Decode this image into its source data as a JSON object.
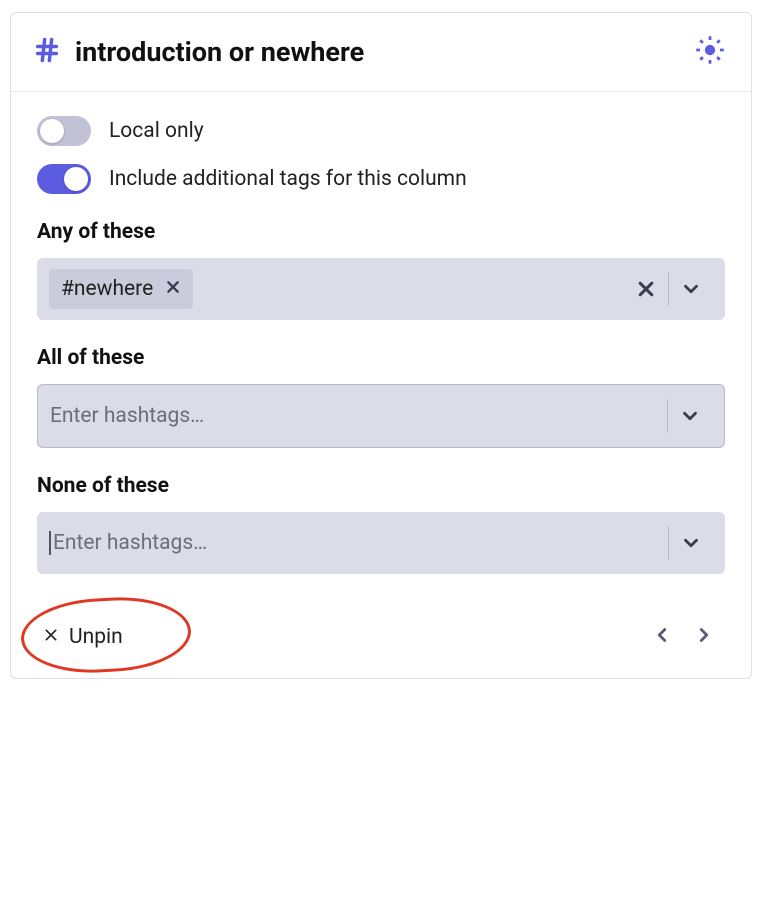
{
  "header": {
    "title": "introduction or newhere"
  },
  "toggles": {
    "local_only": {
      "label": "Local only",
      "on": false
    },
    "include_additional": {
      "label": "Include additional tags for this column",
      "on": true
    }
  },
  "sections": {
    "any": {
      "label": "Any of these",
      "tags": [
        "#newhere"
      ],
      "placeholder": "Enter hashtags…"
    },
    "all": {
      "label": "All of these",
      "placeholder": "Enter hashtags…"
    },
    "none": {
      "label": "None of these",
      "placeholder": "Enter hashtags…"
    }
  },
  "footer": {
    "unpin_label": "Unpin"
  }
}
